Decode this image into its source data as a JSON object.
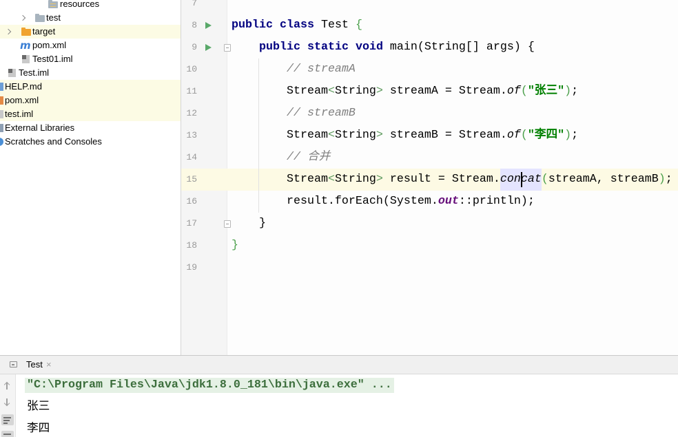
{
  "project_tree": {
    "items": [
      {
        "label": "resources",
        "icon": "resources-folder-icon"
      },
      {
        "label": "test",
        "icon": "folder-icon",
        "collapsed": true
      },
      {
        "label": "target",
        "icon": "excluded-folder-icon",
        "collapsed": true,
        "highlighted": true
      },
      {
        "label": "pom.xml",
        "icon": "maven-icon",
        "icon_glyph": "m"
      },
      {
        "label": "Test01.iml",
        "icon": "module-file-icon"
      },
      {
        "label": "Test.iml",
        "icon": "module-file-icon"
      },
      {
        "label": "HELP.md",
        "icon": "markdown-file-icon",
        "highlighted": true
      },
      {
        "label": "pom.xml",
        "icon": "xml-file-icon",
        "highlighted": true
      },
      {
        "label": "test.iml",
        "icon": "module-file-icon",
        "highlighted": true
      },
      {
        "label": "External Libraries",
        "icon": "external-libraries-icon"
      },
      {
        "label": "Scratches and Consoles",
        "icon": "scratches-icon"
      }
    ]
  },
  "editor": {
    "line_numbers": [
      "7",
      "8",
      "9",
      "10",
      "11",
      "12",
      "13",
      "14",
      "15",
      "16",
      "17",
      "18",
      "19"
    ],
    "current_line": 15,
    "run_gutter_lines": [
      8,
      9
    ],
    "lines": [
      {
        "tokens": []
      },
      {
        "tokens": [
          {
            "keyword": "public"
          },
          {
            "plain": " "
          },
          {
            "keyword": "class"
          },
          {
            "plain": " Test "
          },
          {
            "bracket": "{"
          }
        ]
      },
      {
        "tokens": [
          {
            "plain": "    "
          },
          {
            "keyword": "public"
          },
          {
            "plain": " "
          },
          {
            "keyword": "static"
          },
          {
            "plain": " "
          },
          {
            "keyword": "void"
          },
          {
            "plain": " main(String[] args) {"
          }
        ]
      },
      {
        "tokens": [
          {
            "plain": "        "
          },
          {
            "comment": "// streamA"
          }
        ]
      },
      {
        "tokens": [
          {
            "plain": "        Stream"
          },
          {
            "angle": "<"
          },
          {
            "plain": "String"
          },
          {
            "angle": ">"
          },
          {
            "plain": " streamA = Stream."
          },
          {
            "static_method": "of"
          },
          {
            "bracket": "("
          },
          {
            "string": "\"张三\""
          },
          {
            "bracket": ")"
          },
          {
            "plain": ";"
          }
        ]
      },
      {
        "tokens": [
          {
            "plain": "        "
          },
          {
            "comment": "// streamB"
          }
        ]
      },
      {
        "tokens": [
          {
            "plain": "        Stream"
          },
          {
            "angle": "<"
          },
          {
            "plain": "String"
          },
          {
            "angle": ">"
          },
          {
            "plain": " streamB = Stream."
          },
          {
            "static_method": "of"
          },
          {
            "bracket": "("
          },
          {
            "string": "\"李四\""
          },
          {
            "bracket": ")"
          },
          {
            "plain": ";"
          }
        ]
      },
      {
        "tokens": [
          {
            "plain": "        "
          },
          {
            "comment": "// 合并"
          }
        ]
      },
      {
        "tokens": [
          {
            "plain": "        Stream"
          },
          {
            "angle": "<"
          },
          {
            "plain": "String"
          },
          {
            "angle": ">"
          },
          {
            "plain": " result = Stream."
          },
          {
            "static_method_usage": "concat"
          },
          {
            "bracket": "("
          },
          {
            "plain": "streamA, streamB"
          },
          {
            "bracket": ")"
          },
          {
            "plain": ";"
          }
        ]
      },
      {
        "tokens": [
          {
            "plain": "        result.forEach(System."
          },
          {
            "static_field": "out"
          },
          {
            "plain": "::println);"
          }
        ]
      },
      {
        "tokens": [
          {
            "plain": "    }"
          }
        ]
      },
      {
        "tokens": [
          {
            "bracket": "}"
          }
        ]
      },
      {
        "tokens": []
      }
    ]
  },
  "run_panel": {
    "tab_label": "Test",
    "tab_close": "×",
    "console_lines": [
      "\"C:\\Program Files\\Java\\jdk1.8.0_181\\bin\\java.exe\" ...",
      "张三",
      "李四"
    ]
  },
  "colors": {
    "keyword": "#000080",
    "string": "#008000",
    "comment": "#808080",
    "static-field": "#660e7a",
    "bracket": "#4a9f4a",
    "angle-bracket": "#5e9a5e",
    "run-icon": "#59a869",
    "line-number": "#999999",
    "current-line": "#fdfae4",
    "usage-highlight": "#e4e4ff",
    "tree-highlight": "#fcfbe4",
    "console-command-bg": "#e5f1e5",
    "console-command-text": "#3c6e3c"
  }
}
